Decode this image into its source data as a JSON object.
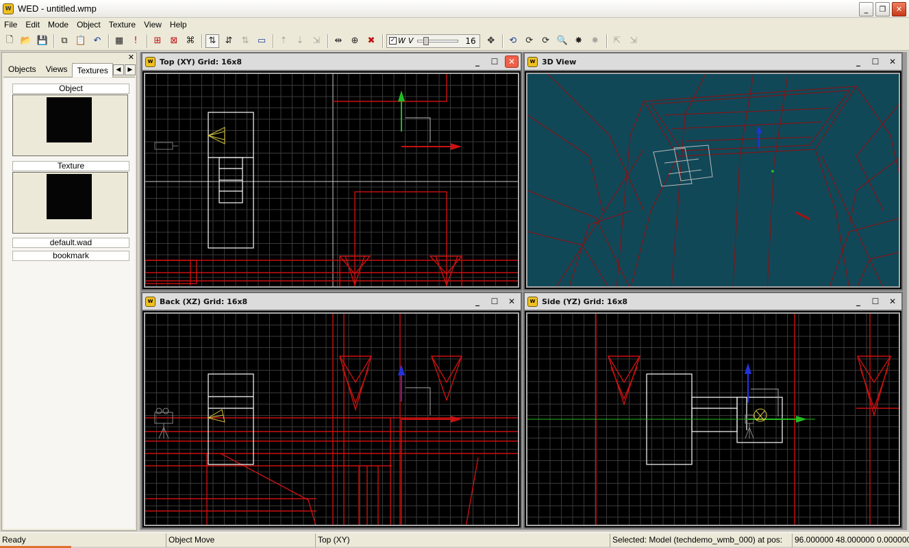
{
  "window": {
    "title": "WED - untitled.wmp",
    "icon": "wed-app-icon"
  },
  "menu": [
    "File",
    "Edit",
    "Mode",
    "Object",
    "Texture",
    "View",
    "Help"
  ],
  "toolbar": {
    "grid_value": "16",
    "check_w": "W",
    "check_v": "V"
  },
  "left_panel": {
    "tabs": [
      "Objects",
      "Views",
      "Textures"
    ],
    "active_tab": "Textures",
    "object_label": "Object",
    "texture_label": "Texture",
    "wad_label": "default.wad",
    "bookmark_label": "bookmark"
  },
  "viewports": {
    "top": {
      "title": "Top (XY) Grid: 16x8"
    },
    "view3d": {
      "title": "3D View"
    },
    "back": {
      "title": "Back (XZ) Grid: 16x8"
    },
    "side": {
      "title": "Side (YZ) Grid: 16x8"
    }
  },
  "status": {
    "state": "Ready",
    "mode": "Object Move",
    "view": "Top (XY)",
    "selected": "Selected: Model (techdemo_wmb_000) at pos:",
    "position": "96.000000 48.000000 0.000000"
  },
  "colors": {
    "wire_red": "#cc1111",
    "grid_line": "#3a3a3a",
    "view3d_bg": "#114858",
    "axis_green": "#22bb22",
    "axis_blue": "#2233dd"
  }
}
